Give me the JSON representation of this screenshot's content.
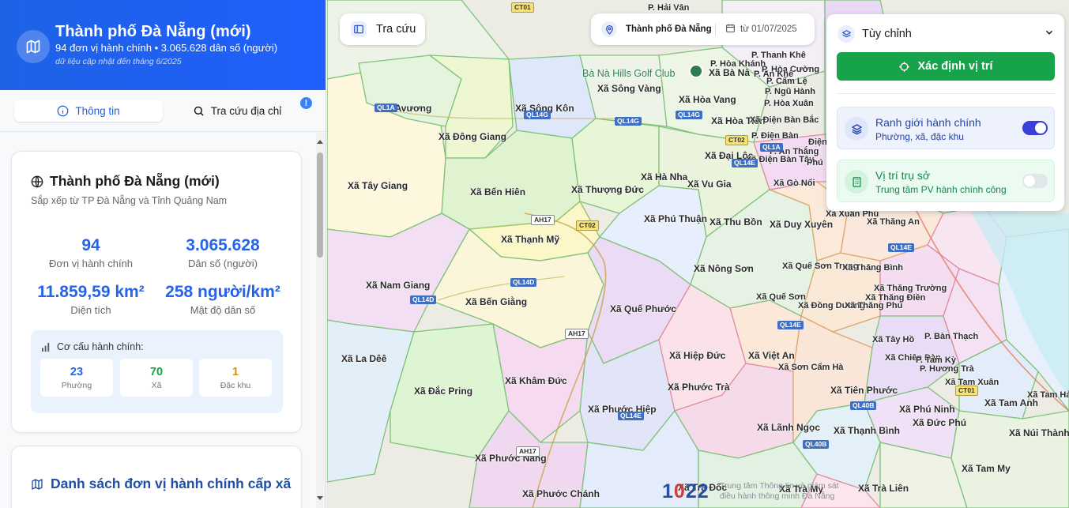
{
  "header": {
    "title": "Thành phố Đà Nẵng (mới)",
    "subtitle": "94 đơn vị hành chính • 3.065.628 dân số (người)",
    "note": "dữ liệu cập nhật đến tháng 6/2025"
  },
  "tabs": [
    {
      "label": "Thông tin"
    },
    {
      "label": "Tra cứu địa chỉ"
    }
  ],
  "tab_badge": "!",
  "card": {
    "title": "Thành phố Đà Nẵng (mới)",
    "subtitle": "Sắp xếp từ TP Đà Nẵng và Tỉnh Quảng Nam",
    "stats": [
      {
        "value": "94",
        "label": "Đơn vị hành chính"
      },
      {
        "value": "3.065.628",
        "label": "Dân số (người)"
      },
      {
        "value": "11.859,59 km²",
        "label": "Diện tích"
      },
      {
        "value": "258 người/km²",
        "label": "Mật độ dân số"
      }
    ],
    "structure": {
      "title": "Cơ cấu hành chính:",
      "items": [
        {
          "value": "23",
          "label": "Phường",
          "color": "#2563eb"
        },
        {
          "value": "70",
          "label": "Xã",
          "color": "#16a34a"
        },
        {
          "value": "1",
          "label": "Đặc khu",
          "color": "#ea8c00"
        }
      ]
    }
  },
  "list_card": {
    "title": "Danh sách đơn vị hành chính cấp xã"
  },
  "map": {
    "search_button": "Tra cứu",
    "location": "Thành phố Đà Nẵng",
    "date": "từ 01/07/2025",
    "panel": {
      "title": "Tùy chỉnh",
      "locate_button": "Xác định vị trí",
      "options": [
        {
          "title": "Ranh giới hành chính",
          "subtitle": "Phường, xã, đặc khu",
          "enabled": true
        },
        {
          "title": "Vị trí trụ sở",
          "subtitle": "Trung tâm PV hành chính công",
          "enabled": false
        }
      ]
    },
    "attribution_line1": "Trung tâm Thông tin và giám sát",
    "attribution_line2": "điều hành thông minh Đà Nẵng",
    "logo": {
      "a": "1",
      "b": "0",
      "c": "22"
    },
    "poi": "Bà Nà Hills Golf Club",
    "labels": [
      "Xã Avương",
      "Xã Sông Kôn",
      "Xã Đông Giang",
      "Xã Tây Giang",
      "Xã Bến Hiên",
      "Xã Thượng Đức",
      "Xã Hà Nha",
      "Xã Vu Gia",
      "Xã Đại Lộc",
      "Xã Sông Vàng",
      "Xã Hòa Vang",
      "Xã Hòa Tiến",
      "Xã Bà Nà",
      "P. Hải Vân",
      "P. Hòa Khánh",
      "P. Thanh Khê",
      "P. Hòa Cường",
      "P. Ngũ Hành",
      "P. Hòa Xuân",
      "P. Cẩm Lệ",
      "P. An Khê",
      "Xã Phú Thuận",
      "Xã Thu Bồn",
      "Xã Duy Xuyên",
      "Xã Xuân Phú",
      "Xã Thăng An",
      "Xã Thạnh Mỹ",
      "Xã Nam Giang",
      "Xã Bến Giằng",
      "Xã Nông Sơn",
      "Xã Quế Sơn Trung",
      "Xã Thăng Bình",
      "Xã Quế Sơn",
      "Xã Đồng Dương",
      "Xã Thăng Phú",
      "Xã Thăng Điền",
      "Xã Thăng Trường",
      "Xã Quế Phước",
      "Xã La Dêê",
      "Xã Đắc Pring",
      "Xã Khâm Đức",
      "Xã Phước Hiệp",
      "Xã Hiệp Đức",
      "Xã Việt An",
      "Xã Phước Trà",
      "Xã Sơn Cẩm Hà",
      "Xã Tây Hồ",
      "P. Bàn Thạch",
      "Xã Chiên Đàn",
      "P. Hương Trà",
      "P. Tam Kỳ",
      "Xã Tam Xuân",
      "Xã Tiên Phước",
      "Xã Phú Ninh",
      "Xã Đức Phú",
      "Xã Lãnh Ngọc",
      "Xã Thạnh Bình",
      "Xã Phước Năng",
      "Xã Phước Chánh",
      "Xã Trà Đốc",
      "Xã Trà My",
      "Xã Trà Liên",
      "Xã Tam My",
      "Xã Núi Thành",
      "Xã Tam Anh",
      "Xã Tam Hải",
      "P. Điện Bàn",
      "P. An Thắng",
      "Xã Điện Bàn Tây",
      "Xã Gò Nổi",
      "Xã Điện Bàn Bắc",
      "Phú",
      "Điện"
    ],
    "shields": [
      "CT01",
      "QL14G",
      "QL14G",
      "QL14G",
      "CT02",
      "AH17",
      "QL14D",
      "QL14D",
      "AH17",
      "QL14E",
      "QL14E",
      "QL40B",
      "QL40B",
      "CT01",
      "QL14E",
      "AH17",
      "QL1A",
      "CT02",
      "QL14E",
      "QL1A"
    ]
  },
  "colors": {
    "header_blue": "#1f5ff2",
    "accent_blue": "#2563eb",
    "green": "#16a34a",
    "orange": "#ea8c00"
  }
}
